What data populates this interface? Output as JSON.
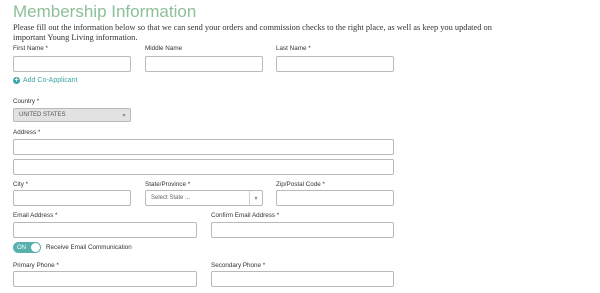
{
  "header": {
    "title": "Membership Information",
    "intro": "Please fill out the information below so that we can send your orders and commission checks to the right place, as well as keep you updated on important Young Living information."
  },
  "name": {
    "first_label": "First Name *",
    "first_value": "",
    "middle_label": "Middle Name",
    "middle_value": "",
    "last_label": "Last Name *",
    "last_value": ""
  },
  "co_applicant": {
    "icon": "plus-circle-icon",
    "label": "Add Co-Applicant"
  },
  "country": {
    "label": "Country *",
    "selected": "UNITED STATES"
  },
  "address": {
    "label": "Address *",
    "line1_value": "",
    "line2_value": ""
  },
  "city": {
    "label": "City *",
    "value": ""
  },
  "state": {
    "label": "State/Province *",
    "selected": "Select State ..."
  },
  "zip": {
    "label": "Zip/Postal Code *",
    "value": ""
  },
  "email": {
    "label": "Email Address *",
    "value": "",
    "confirm_label": "Confirm Email Address *",
    "confirm_value": ""
  },
  "email_pref": {
    "toggle_text": "ON",
    "label": "Receive Email Communication"
  },
  "phone": {
    "primary_label": "Primary Phone *",
    "primary_value": "",
    "secondary_label": "Secondary Phone *",
    "secondary_value": ""
  },
  "colors": {
    "title": "#8dbf97",
    "accent": "#3fa5a3",
    "toggle_on": "#56b0ad",
    "disabled_bg": "#e2e2e2"
  }
}
